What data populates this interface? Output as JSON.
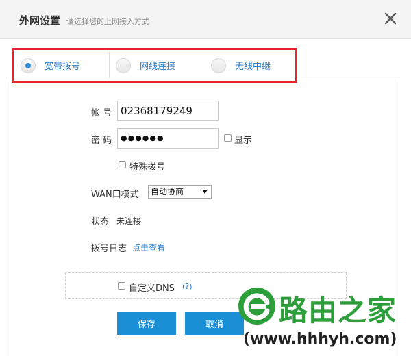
{
  "dialog": {
    "title": "外网设置",
    "subtitle": "请选择您的上网接入方式",
    "close_icon": "×"
  },
  "tabs": [
    {
      "label": "宽带拨号",
      "selected": true
    },
    {
      "label": "网线连接",
      "selected": false
    },
    {
      "label": "无线中继",
      "selected": false
    }
  ],
  "form": {
    "account_label": "帐 号",
    "account_value": "02368179249",
    "password_label": "密 码",
    "password_mask": "●●●●●●",
    "show_label": "显示",
    "special_dial_label": "特殊拨号",
    "wan_mode_label": "WAN口模式",
    "wan_mode_value": "自动协商",
    "status_label": "状态",
    "status_value": "未连接",
    "dial_log_label": "拨号日志",
    "dial_log_link": "点击查看",
    "custom_dns_label": "自定义DNS",
    "help_link": "(?)"
  },
  "buttons": {
    "save": "保存",
    "cancel": "取消"
  },
  "watermark": {
    "brand": "路由之家",
    "url": "(www.hhhyh.com)"
  },
  "colors": {
    "accent": "#1a8fd6",
    "highlight_border": "#e8242c",
    "watermark_green": "#2c9f3a"
  }
}
